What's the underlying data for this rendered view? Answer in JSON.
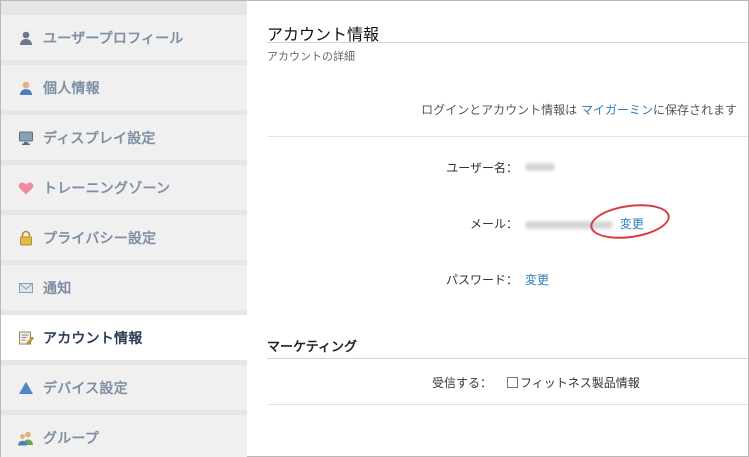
{
  "sidebar": {
    "items": [
      {
        "label": "ユーザープロフィール",
        "icon": "user-icon"
      },
      {
        "label": "個人情報",
        "icon": "person-icon"
      },
      {
        "label": "ディスプレイ設定",
        "icon": "monitor-icon"
      },
      {
        "label": "トレーニングゾーン",
        "icon": "heart-icon"
      },
      {
        "label": "プライバシー設定",
        "icon": "lock-icon"
      },
      {
        "label": "通知",
        "icon": "mail-icon"
      },
      {
        "label": "アカウント情報",
        "icon": "account-edit-icon",
        "active": true
      },
      {
        "label": "デバイス設定",
        "icon": "triangle-icon"
      },
      {
        "label": "グループ",
        "icon": "group-icon"
      }
    ]
  },
  "main": {
    "title": "アカウント情報",
    "subtitle": "アカウントの詳細",
    "storage_note": {
      "prefix": "ログインとアカウント情報は ",
      "link": "マイガーミン",
      "suffix": "に保存されます"
    },
    "fields": {
      "username_label": "ユーザー名：",
      "email_label": "メール：",
      "email_change": "変更",
      "password_label": "パスワード：",
      "password_change": "変更"
    },
    "marketing": {
      "heading": "マーケティング",
      "receive_label": "受信する：",
      "checkbox_label": "フィットネス製品情報"
    }
  },
  "colors": {
    "accent_link": "#2a7fc1",
    "highlight": "#d9393f",
    "sidebar_text": "#7e8fa3",
    "sidebar_active_text": "#2b3d55"
  }
}
